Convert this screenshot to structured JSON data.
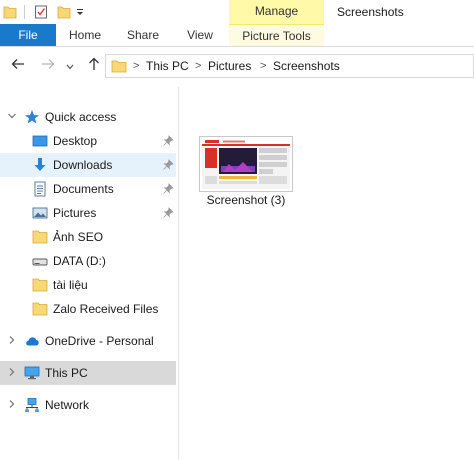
{
  "titlebar": {
    "window_title": "Screenshots",
    "context_group_label": "Manage"
  },
  "ribbon": {
    "tabs": [
      {
        "label": "File"
      },
      {
        "label": "Home"
      },
      {
        "label": "Share"
      },
      {
        "label": "View"
      },
      {
        "label": "Picture Tools"
      }
    ]
  },
  "address": {
    "breadcrumbs": [
      "This PC",
      "Pictures",
      "Screenshots"
    ],
    "separator": ">"
  },
  "navpane": {
    "quick_access": "Quick access",
    "items": [
      {
        "label": "Desktop",
        "icon": "desktop-icon",
        "pinned": true
      },
      {
        "label": "Downloads",
        "icon": "download-arrow-icon",
        "pinned": true
      },
      {
        "label": "Documents",
        "icon": "documents-icon",
        "pinned": true
      },
      {
        "label": "Pictures",
        "icon": "pictures-icon",
        "pinned": true
      },
      {
        "label": "Ảnh SEO",
        "icon": "folder-icon",
        "pinned": false
      },
      {
        "label": "DATA (D:)",
        "icon": "drive-icon",
        "pinned": false
      },
      {
        "label": "tài liệu",
        "icon": "folder-icon",
        "pinned": false
      },
      {
        "label": "Zalo Received Files",
        "icon": "folder-icon",
        "pinned": false
      }
    ],
    "onedrive": "OneDrive - Personal",
    "this_pc": "This PC",
    "network": "Network"
  },
  "files": [
    {
      "name": "Screenshot (3)",
      "icon": "image-thumbnail"
    }
  ],
  "colors": {
    "accent": "#1979ca",
    "manage_tab": "#fff9a8",
    "folder": "#f8d775",
    "selection": "#e5f1fb",
    "this_pc_selection": "#d9d9d9"
  }
}
